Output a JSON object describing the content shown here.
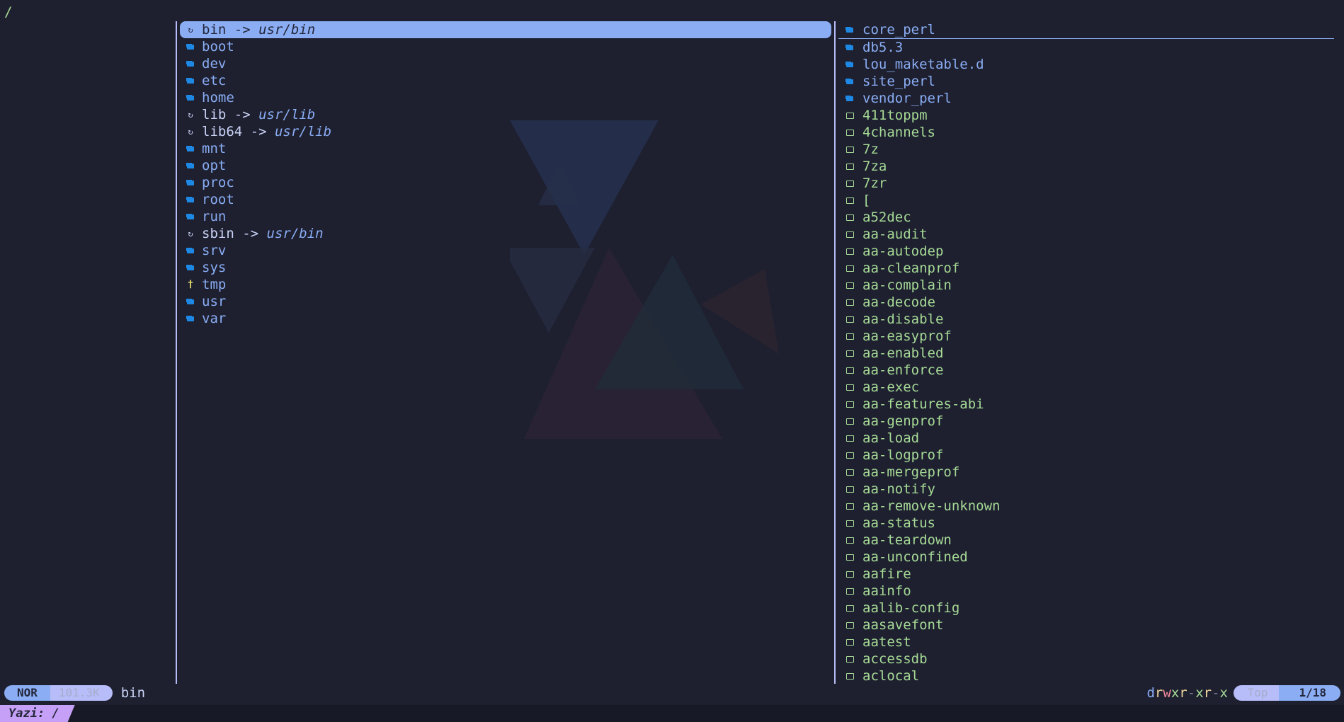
{
  "header": {
    "path": "/"
  },
  "current": {
    "entries": [
      {
        "name": "bin",
        "type": "link",
        "target": "usr/bin",
        "icon": "symlink-icon",
        "selected": true
      },
      {
        "name": "boot",
        "type": "dir",
        "icon": "folder-icon"
      },
      {
        "name": "dev",
        "type": "dir",
        "icon": "folder-icon"
      },
      {
        "name": "etc",
        "type": "dir",
        "icon": "folder-icon"
      },
      {
        "name": "home",
        "type": "dir",
        "icon": "folder-icon"
      },
      {
        "name": "lib",
        "type": "link",
        "target": "usr/lib",
        "icon": "symlink-icon"
      },
      {
        "name": "lib64",
        "type": "link",
        "target": "usr/lib",
        "icon": "symlink-icon"
      },
      {
        "name": "mnt",
        "type": "dir",
        "icon": "folder-icon"
      },
      {
        "name": "opt",
        "type": "dir",
        "icon": "folder-icon"
      },
      {
        "name": "proc",
        "type": "dir",
        "icon": "folder-icon"
      },
      {
        "name": "root",
        "type": "dir",
        "icon": "folder-icon"
      },
      {
        "name": "run",
        "type": "dir",
        "icon": "folder-icon"
      },
      {
        "name": "sbin",
        "type": "link",
        "target": "usr/bin",
        "icon": "symlink-icon"
      },
      {
        "name": "srv",
        "type": "dir",
        "icon": "folder-icon"
      },
      {
        "name": "sys",
        "type": "dir",
        "icon": "folder-icon"
      },
      {
        "name": "tmp",
        "type": "dir",
        "icon": "pin-icon"
      },
      {
        "name": "usr",
        "type": "dir",
        "icon": "folder-icon"
      },
      {
        "name": "var",
        "type": "dir",
        "icon": "folder-icon"
      }
    ]
  },
  "preview": {
    "entries": [
      {
        "name": "core_perl",
        "type": "dir",
        "hovered": true
      },
      {
        "name": "db5.3",
        "type": "dir"
      },
      {
        "name": "lou_maketable.d",
        "type": "dir"
      },
      {
        "name": "site_perl",
        "type": "dir"
      },
      {
        "name": "vendor_perl",
        "type": "dir"
      },
      {
        "name": "411toppm",
        "type": "exec"
      },
      {
        "name": "4channels",
        "type": "exec"
      },
      {
        "name": "7z",
        "type": "exec"
      },
      {
        "name": "7za",
        "type": "exec"
      },
      {
        "name": "7zr",
        "type": "exec"
      },
      {
        "name": "[",
        "type": "exec"
      },
      {
        "name": "a52dec",
        "type": "exec"
      },
      {
        "name": "aa-audit",
        "type": "exec"
      },
      {
        "name": "aa-autodep",
        "type": "exec"
      },
      {
        "name": "aa-cleanprof",
        "type": "exec"
      },
      {
        "name": "aa-complain",
        "type": "exec"
      },
      {
        "name": "aa-decode",
        "type": "exec"
      },
      {
        "name": "aa-disable",
        "type": "exec"
      },
      {
        "name": "aa-easyprof",
        "type": "exec"
      },
      {
        "name": "aa-enabled",
        "type": "exec"
      },
      {
        "name": "aa-enforce",
        "type": "exec"
      },
      {
        "name": "aa-exec",
        "type": "exec"
      },
      {
        "name": "aa-features-abi",
        "type": "exec"
      },
      {
        "name": "aa-genprof",
        "type": "exec"
      },
      {
        "name": "aa-load",
        "type": "exec"
      },
      {
        "name": "aa-logprof",
        "type": "exec"
      },
      {
        "name": "aa-mergeprof",
        "type": "exec"
      },
      {
        "name": "aa-notify",
        "type": "exec"
      },
      {
        "name": "aa-remove-unknown",
        "type": "exec"
      },
      {
        "name": "aa-status",
        "type": "exec"
      },
      {
        "name": "aa-teardown",
        "type": "exec"
      },
      {
        "name": "aa-unconfined",
        "type": "exec"
      },
      {
        "name": "aafire",
        "type": "exec"
      },
      {
        "name": "aainfo",
        "type": "exec"
      },
      {
        "name": "aalib-config",
        "type": "exec"
      },
      {
        "name": "aasavefont",
        "type": "exec"
      },
      {
        "name": "aatest",
        "type": "exec"
      },
      {
        "name": "accessdb",
        "type": "exec"
      },
      {
        "name": "aclocal",
        "type": "exec"
      }
    ]
  },
  "status": {
    "mode": "NOR",
    "size": "101.3K",
    "hovered_name": "bin",
    "permissions": [
      "d",
      "r",
      "w",
      "x",
      "r",
      "-",
      "x",
      "r",
      "-",
      "x"
    ],
    "scroll": "Top",
    "position": "1/18"
  },
  "title_bar": {
    "tab": "Yazi: /"
  },
  "colors": {
    "background": "#1e2030",
    "accent_blue": "#8aadf4",
    "folder_blue": "#1e88e5",
    "exec_green": "#a6da95",
    "divider": "#b7bdf8",
    "title_tab": "#c6a0f6"
  }
}
